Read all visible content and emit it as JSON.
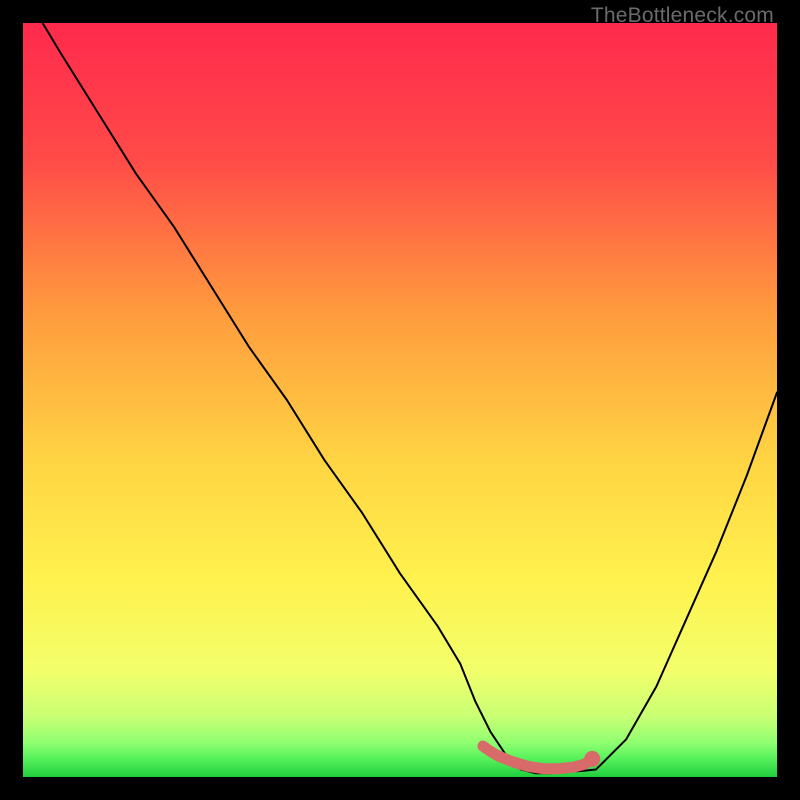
{
  "watermark": "TheBottleneck.com",
  "colors": {
    "background": "#000000",
    "gradient_top": "#ff2a4d",
    "gradient_mid1": "#ff8a3a",
    "gradient_mid2": "#ffe24a",
    "gradient_mid3": "#f3ff6a",
    "gradient_green_light": "#9dff7a",
    "gradient_green": "#29e04e",
    "line_color": "#000000",
    "marker_red": "#d96a6a",
    "watermark_text": "#6b6b6b"
  },
  "chart_data": {
    "type": "line",
    "title": "",
    "xlabel": "",
    "ylabel": "",
    "xlim": [
      0,
      100
    ],
    "ylim": [
      0,
      100
    ],
    "series": [
      {
        "name": "bottleneck-curve",
        "x": [
          0,
          2,
          5,
          10,
          15,
          20,
          25,
          30,
          35,
          40,
          45,
          50,
          55,
          58,
          60,
          62,
          64,
          66,
          68,
          70,
          72,
          74,
          76,
          80,
          84,
          88,
          92,
          96,
          100
        ],
        "y": [
          105,
          101,
          96,
          88,
          80,
          73,
          65,
          57,
          50,
          42,
          35,
          27,
          20,
          15,
          10,
          6,
          3,
          1,
          0.5,
          0.5,
          0.7,
          0.8,
          1,
          5,
          12,
          21,
          30,
          40,
          51
        ]
      },
      {
        "name": "optimal-marker",
        "type": "scatter",
        "x": [
          61,
          62,
          63,
          65,
          67,
          69,
          71,
          73,
          74.5,
          75.5
        ],
        "y": [
          4.1,
          3.4,
          2.8,
          2.0,
          1.4,
          1.1,
          1.1,
          1.3,
          1.7,
          2.4
        ]
      }
    ]
  }
}
